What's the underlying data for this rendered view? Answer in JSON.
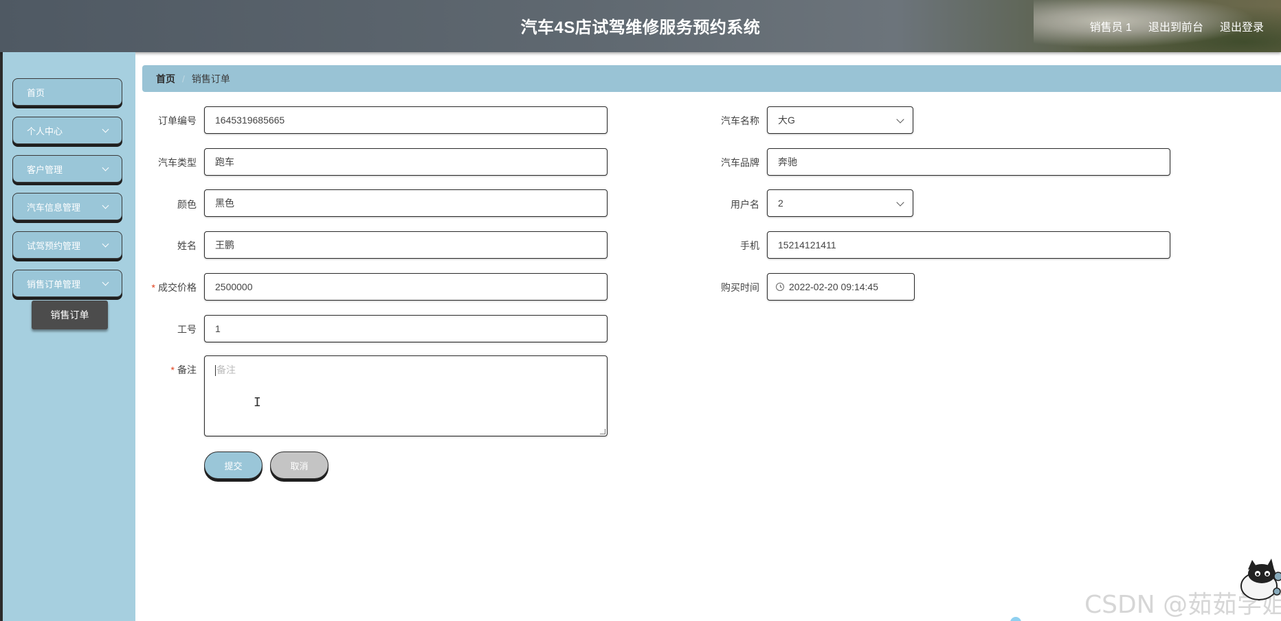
{
  "header": {
    "title": "汽车4S店试驾维修服务预约系统",
    "user": "销售员 1",
    "to_front": "退出到前台",
    "logout": "退出登录"
  },
  "sidebar": {
    "items": [
      {
        "label": "首页",
        "has_arrow": false
      },
      {
        "label": "个人中心",
        "has_arrow": true
      },
      {
        "label": "客户管理",
        "has_arrow": true
      },
      {
        "label": "汽车信息管理",
        "has_arrow": true
      },
      {
        "label": "试驾预约管理",
        "has_arrow": true
      },
      {
        "label": "销售订单管理",
        "has_arrow": true
      }
    ],
    "sub_item": "销售订单"
  },
  "breadcrumb": {
    "home": "首页",
    "separator": "/",
    "current": "销售订单"
  },
  "form": {
    "order_no": {
      "label": "订单编号",
      "value": "1645319685665"
    },
    "car_type": {
      "label": "汽车类型",
      "value": "跑车"
    },
    "color": {
      "label": "颜色",
      "value": "黑色"
    },
    "name": {
      "label": "姓名",
      "value": "王鹏"
    },
    "price": {
      "label": "成交价格",
      "value": "2500000",
      "required": "*"
    },
    "staff_no": {
      "label": "工号",
      "value": "1"
    },
    "remark": {
      "label": "备注",
      "placeholder": "备注",
      "required": "*"
    },
    "car_name": {
      "label": "汽车名称",
      "value": "大G"
    },
    "car_brand": {
      "label": "汽车品牌",
      "value": "奔驰"
    },
    "username": {
      "label": "用户名",
      "value": "2"
    },
    "phone": {
      "label": "手机",
      "value": "15214121411"
    },
    "buy_time": {
      "label": "购买时间",
      "value": "2022-02-20 09:14:45"
    }
  },
  "buttons": {
    "submit": "提交",
    "cancel": "取消"
  },
  "watermark": "CSDN @茹茹学姐",
  "colors": {
    "sidebar_bg": "#a6cfdf",
    "menu_button": "#9ac6d8",
    "breadcrumb_bg": "#99c3d5",
    "active_sub": "#4c4c4c",
    "required": "#e0401c"
  }
}
